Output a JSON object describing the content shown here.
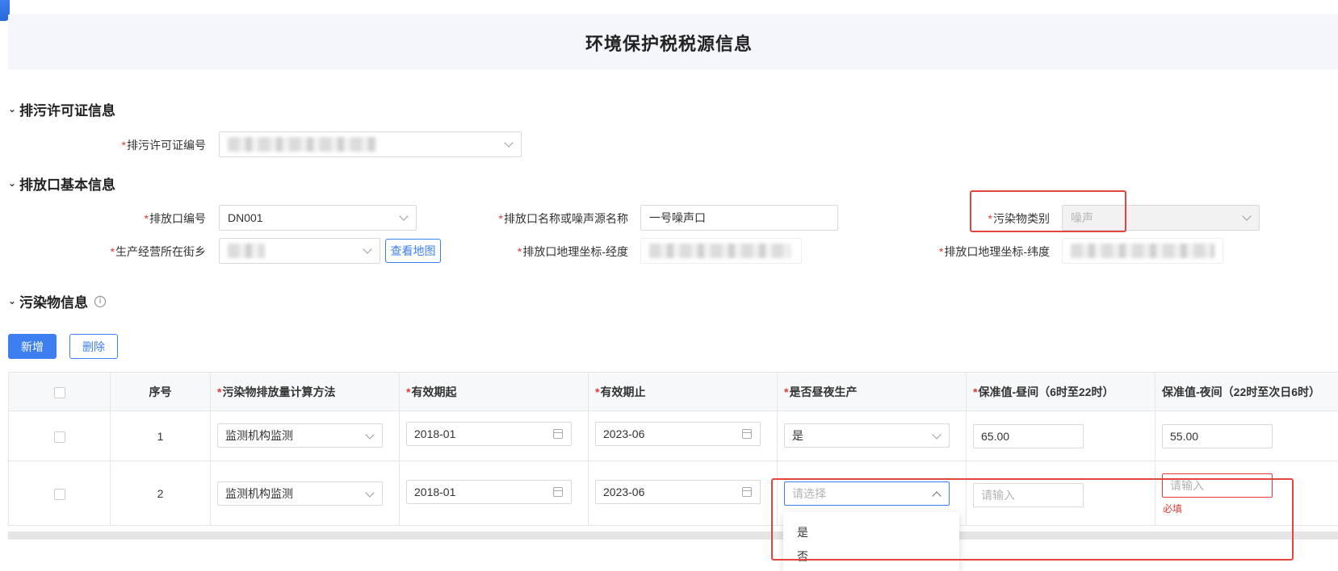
{
  "page": {
    "title": "环境保护税税源信息"
  },
  "sections": {
    "permit": {
      "title": "排污许可证信息"
    },
    "outlet": {
      "title": "排放口基本信息"
    },
    "pollutant": {
      "title": "污染物信息",
      "info_icon": "info-circle-icon"
    }
  },
  "permit": {
    "number_label": "排污许可证编号",
    "number_value": ""
  },
  "outlet": {
    "code_label": "排放口编号",
    "code_value": "DN001",
    "name_label": "排放口名称或噪声源名称",
    "name_value": "一号噪声口",
    "category_label": "污染物类别",
    "category_value": "噪声",
    "street_label": "生产经营所在街乡",
    "street_value": "",
    "map_button": "查看地图",
    "lng_label": "排放口地理坐标-经度",
    "lng_value": "",
    "lat_label": "排放口地理坐标-纬度",
    "lat_value": ""
  },
  "actions": {
    "add": "新增",
    "delete": "删除"
  },
  "table": {
    "headers": {
      "index": "序号",
      "method": "污染物排放量计算方法",
      "start": "有效期起",
      "end": "有效期止",
      "daynight": "是否昼夜生产",
      "day_value": "保准值-昼间（6时至22时）",
      "night_value": "保准值-夜间（22时至次日6时）"
    },
    "rows": [
      {
        "index": "1",
        "method": "监测机构监测",
        "start": "2018-01",
        "end": "2023-06",
        "daynight": "是",
        "day_value": "65.00",
        "night_value": "55.00"
      },
      {
        "index": "2",
        "method": "监测机构监测",
        "start": "2018-01",
        "end": "2023-06",
        "daynight": "",
        "day_value": "",
        "night_value": ""
      }
    ],
    "placeholders": {
      "select": "请选择",
      "input": "请输入"
    },
    "required_msg": "必填"
  },
  "dropdown": {
    "options": [
      "是",
      "否"
    ]
  },
  "colors": {
    "primary": "#3d7ff0",
    "required": "#e53935",
    "highlight": "#e0463c"
  }
}
